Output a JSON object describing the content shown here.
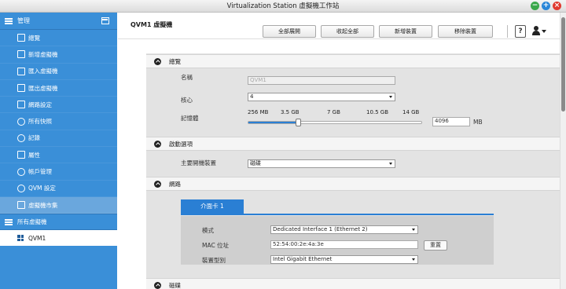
{
  "window": {
    "title": "Virtualization Station 虛擬機工作站"
  },
  "sidebar": {
    "header": "管理",
    "items": [
      {
        "label": "總覽",
        "icon": "overview-icon"
      },
      {
        "label": "新增虛擬機",
        "icon": "plus-icon"
      },
      {
        "label": "匯入虛擬機",
        "icon": "import-icon"
      },
      {
        "label": "匯出虛擬機",
        "icon": "export-icon"
      },
      {
        "label": "網路設定",
        "icon": "network-icon"
      },
      {
        "label": "所有快照",
        "icon": "snapshot-icon"
      },
      {
        "label": "記錄",
        "icon": "log-icon"
      },
      {
        "label": "屬性",
        "icon": "properties-icon"
      },
      {
        "label": "帳戶管理",
        "icon": "user-account-icon"
      },
      {
        "label": "QVM 設定",
        "icon": "gear-icon"
      },
      {
        "label": "虛擬機市集",
        "icon": "market-icon"
      }
    ],
    "group": "所有虛擬機",
    "vm": "QVM1"
  },
  "toolbar": {
    "title": "QVM1 虛擬機",
    "expand_all": "全部展開",
    "collapse_all": "收起全部",
    "add_device": "新增裝置",
    "remove_device": "移除裝置",
    "help": "?"
  },
  "overview": {
    "header": "總覽",
    "name_label": "名稱",
    "name_value": "QVM1",
    "cores_label": "核心",
    "cores_value": "4",
    "memory_label": "記憶體",
    "memory_ticks": [
      "256 MB",
      "3.5 GB",
      "7 GB",
      "10.5 GB",
      "14 GB"
    ],
    "memory_value": "4096",
    "memory_unit": "MB",
    "memory_fraction": 0.29
  },
  "boot": {
    "header": "啟動選項",
    "boot_label": "主要開機裝置",
    "boot_value": "磁碟"
  },
  "network": {
    "header": "網路",
    "tab": "介面卡 1",
    "mode_label": "模式",
    "mode_value": "Dedicated Interface 1 (Ethernet 2)",
    "mac_label": "MAC 位址",
    "mac_value": "52:54:00:2e:4a:3e",
    "reset_label": "重置",
    "model_label": "裝置型別",
    "model_value": "Intel Gigabit Ethernet"
  },
  "next_section": {
    "header": "磁碟"
  }
}
